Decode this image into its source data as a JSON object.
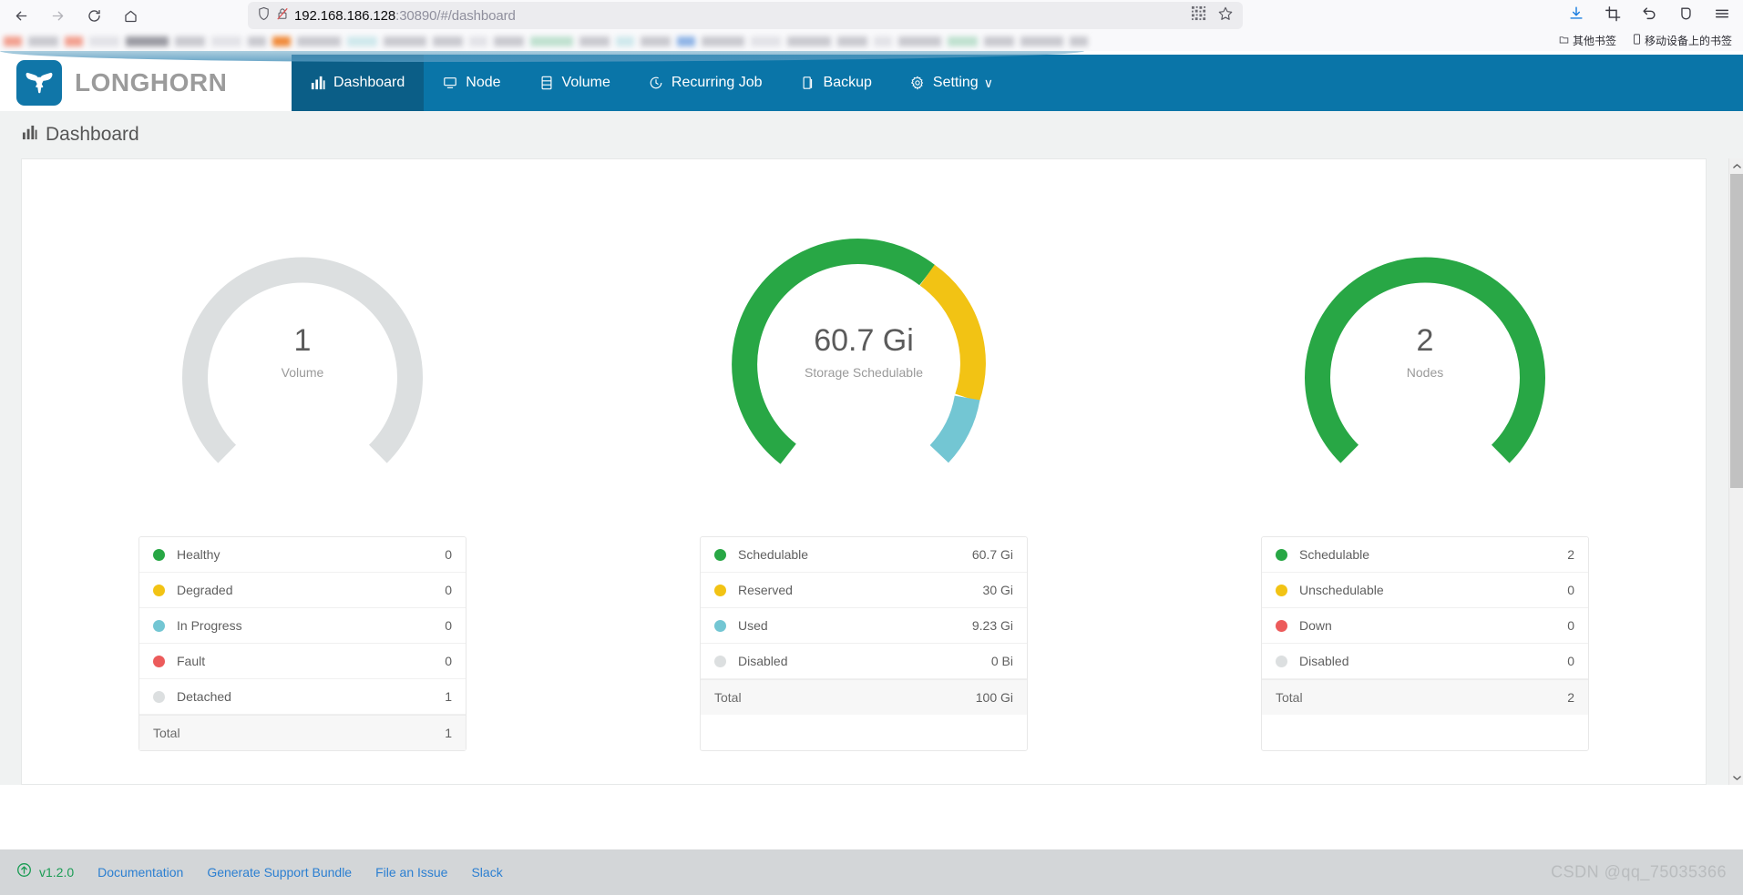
{
  "browser": {
    "back_icon": "back-arrow-icon",
    "forward_icon": "forward-arrow-icon",
    "reload_icon": "reload-icon",
    "home_icon": "home-icon",
    "url_host": "192.168.186.128",
    "url_rest": ":30890/#/dashboard",
    "shield_icon": "shield-icon",
    "insecure_icon": "insecure-lock-icon",
    "qr_icon": "qr-code-icon",
    "bookmark_star_icon": "star-icon",
    "downloads_icon": "downloads-icon",
    "screenshot_icon": "screenshot-icon",
    "undo_icon": "undo-icon",
    "pocket_icon": "pocket-icon",
    "menu_icon": "hamburger-menu-icon",
    "bookmarks": {
      "other_bookmarks": "其他书签",
      "mobile_bookmarks": "移动设备上的书签"
    }
  },
  "header": {
    "brand": "LONGHORN",
    "logo_icon": "longhorn-bull-icon",
    "nav": [
      {
        "label": "Dashboard",
        "icon": "chart-bar-icon",
        "active": true
      },
      {
        "label": "Node",
        "icon": "server-icon",
        "active": false
      },
      {
        "label": "Volume",
        "icon": "database-icon",
        "active": false
      },
      {
        "label": "Recurring Job",
        "icon": "clock-icon",
        "active": false
      },
      {
        "label": "Backup",
        "icon": "copy-icon",
        "active": false
      },
      {
        "label": "Setting",
        "icon": "gear-icon",
        "active": false,
        "caret": "∨"
      }
    ]
  },
  "page": {
    "title": "Dashboard",
    "title_icon": "chart-bar-icon"
  },
  "colors": {
    "green": "#28a745",
    "yellow": "#f2c314",
    "lightblue": "#73c6d3",
    "red": "#ec5b5b",
    "grey": "#dcdfe0",
    "brand_blue": "#0a75a8"
  },
  "chart_data": [
    {
      "type": "pie",
      "title": "Volume",
      "center_value": "1",
      "center_label": "Volume",
      "total": 1,
      "slices": [
        {
          "name": "Healthy",
          "value": 0,
          "color": "#28a745"
        },
        {
          "name": "Degraded",
          "value": 0,
          "color": "#f2c314"
        },
        {
          "name": "In Progress",
          "value": 0,
          "color": "#73c6d3"
        },
        {
          "name": "Fault",
          "value": 0,
          "color": "#ec5b5b"
        },
        {
          "name": "Detached",
          "value": 1,
          "color": "#dcdfe0"
        }
      ],
      "legend_position": "bottom"
    },
    {
      "type": "pie",
      "title": "Storage Schedulable",
      "center_value": "60.7 Gi",
      "center_label": "Storage Schedulable",
      "total": "100 Gi",
      "slices": [
        {
          "name": "Schedulable",
          "value": 60.7,
          "display": "60.7 Gi",
          "color": "#28a745"
        },
        {
          "name": "Reserved",
          "value": 30,
          "display": "30 Gi",
          "color": "#f2c314"
        },
        {
          "name": "Used",
          "value": 9.23,
          "display": "9.23 Gi",
          "color": "#73c6d3"
        },
        {
          "name": "Disabled",
          "value": 0,
          "display": "0 Bi",
          "color": "#dcdfe0"
        }
      ],
      "legend_position": "bottom"
    },
    {
      "type": "pie",
      "title": "Nodes",
      "center_value": "2",
      "center_label": "Nodes",
      "total": 2,
      "slices": [
        {
          "name": "Schedulable",
          "value": 2,
          "color": "#28a745"
        },
        {
          "name": "Unschedulable",
          "value": 0,
          "color": "#f2c314"
        },
        {
          "name": "Down",
          "value": 0,
          "color": "#ec5b5b"
        },
        {
          "name": "Disabled",
          "value": 0,
          "color": "#dcdfe0"
        }
      ],
      "legend_position": "bottom"
    }
  ],
  "gauges": [
    {
      "value": "1",
      "label": "Volume"
    },
    {
      "value": "60.7 Gi",
      "label": "Storage Schedulable"
    },
    {
      "value": "2",
      "label": "Nodes"
    }
  ],
  "legends": [
    {
      "rows": [
        {
          "name": "Healthy",
          "value": "0",
          "color": "#28a745"
        },
        {
          "name": "Degraded",
          "value": "0",
          "color": "#f2c314"
        },
        {
          "name": "In Progress",
          "value": "0",
          "color": "#73c6d3"
        },
        {
          "name": "Fault",
          "value": "0",
          "color": "#ec5b5b"
        },
        {
          "name": "Detached",
          "value": "1",
          "color": "#dcdfe0"
        }
      ],
      "total_label": "Total",
      "total_value": "1"
    },
    {
      "rows": [
        {
          "name": "Schedulable",
          "value": "60.7 Gi",
          "color": "#28a745"
        },
        {
          "name": "Reserved",
          "value": "30 Gi",
          "color": "#f2c314"
        },
        {
          "name": "Used",
          "value": "9.23 Gi",
          "color": "#73c6d3"
        },
        {
          "name": "Disabled",
          "value": "0 Bi",
          "color": "#dcdfe0"
        }
      ],
      "total_label": "Total",
      "total_value": "100 Gi"
    },
    {
      "rows": [
        {
          "name": "Schedulable",
          "value": "2",
          "color": "#28a745"
        },
        {
          "name": "Unschedulable",
          "value": "0",
          "color": "#f2c314"
        },
        {
          "name": "Down",
          "value": "0",
          "color": "#ec5b5b"
        },
        {
          "name": "Disabled",
          "value": "0",
          "color": "#dcdfe0"
        }
      ],
      "total_label": "Total",
      "total_value": "2"
    }
  ],
  "footer": {
    "upgrade_icon": "upgrade-arrow-icon",
    "version": "v1.2.0",
    "links": [
      "Documentation",
      "Generate Support Bundle",
      "File an Issue",
      "Slack"
    ]
  },
  "watermark": "CSDN @qq_75035366"
}
